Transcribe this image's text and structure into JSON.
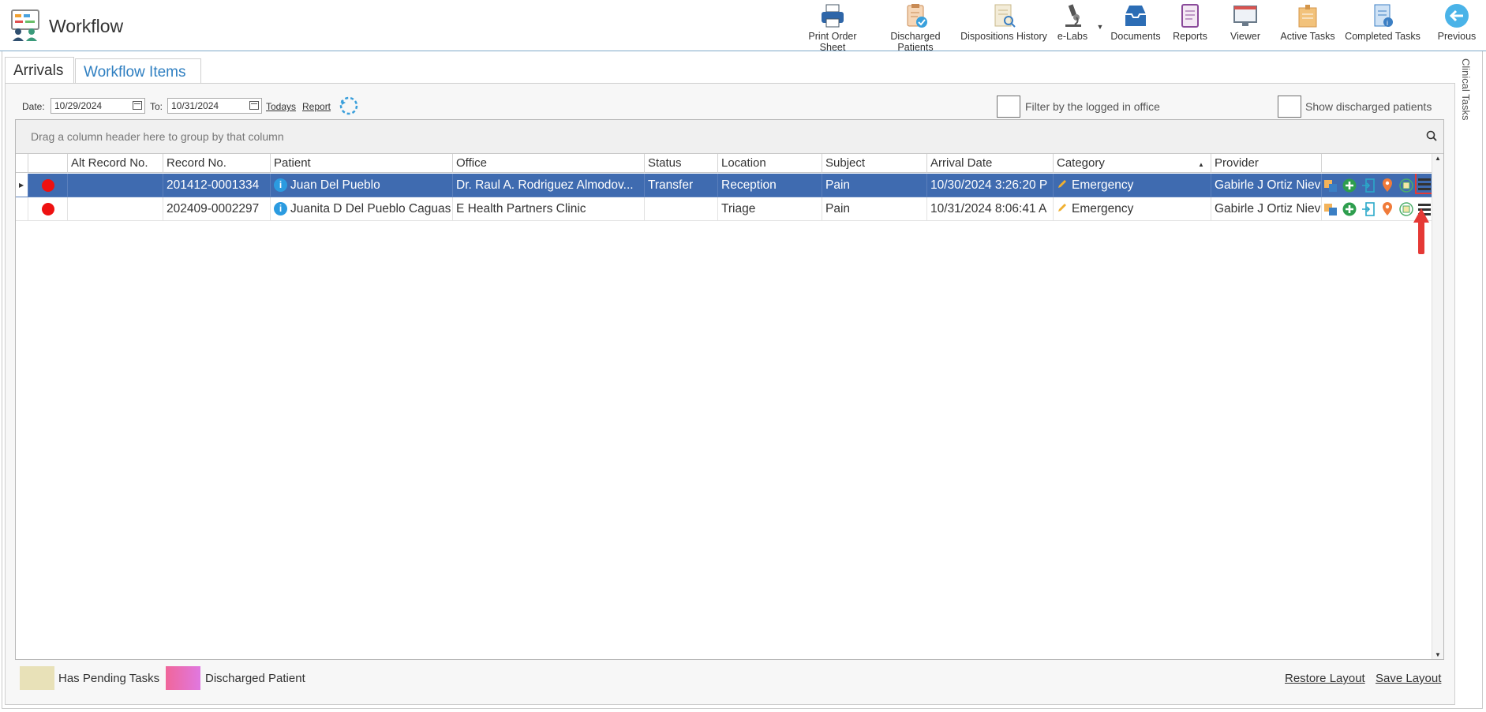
{
  "app": {
    "title": "Workflow"
  },
  "toolbar": {
    "print_order_sheet": "Print Order Sheet",
    "discharged_patients": "Discharged Patients",
    "dispositions_history": "Dispositions History",
    "e_labs": "e-Labs",
    "documents": "Documents",
    "reports": "Reports",
    "viewer": "Viewer",
    "active_tasks": "Active Tasks",
    "completed_tasks": "Completed Tasks",
    "previous": "Previous"
  },
  "tabs": {
    "arrivals": "Arrivals",
    "workflow_items": "Workflow Items"
  },
  "side_panel": {
    "label": "Clinical Tasks"
  },
  "filters": {
    "date_label": "Date:",
    "date_value": "10/29/2024",
    "to_label": "To:",
    "to_value": "10/31/2024",
    "todays": "Todays",
    "report": "Report",
    "filter_office": "Filter by the logged in office",
    "show_discharged": "Show discharged patients"
  },
  "grid": {
    "group_hint": "Drag a column header here to group by that column",
    "columns": {
      "alt_record": "Alt Record No.",
      "record": "Record No.",
      "patient": "Patient",
      "office": "Office",
      "status": "Status",
      "location": "Location",
      "subject": "Subject",
      "arrival": "Arrival Date",
      "category": "Category",
      "provider": "Provider"
    },
    "rows": [
      {
        "alt_record": "",
        "record": "201412-0001334",
        "patient": "Juan Del Pueblo",
        "office": "Dr. Raul A. Rodriguez Almodov...",
        "status": "Transfer",
        "location": "Reception",
        "subject": "Pain",
        "arrival": "10/30/2024 3:26:20 P",
        "category": "Emergency",
        "provider": "Gabirle J Ortiz Nieve"
      },
      {
        "alt_record": "",
        "record": "202409-0002297",
        "patient": "Juanita D Del Pueblo Caguas",
        "office": "E Health Partners Clinic",
        "status": "",
        "location": "Triage",
        "subject": "Pain",
        "arrival": "10/31/2024 8:06:41 A",
        "category": "Emergency",
        "provider": "Gabirle J Ortiz Nieve"
      }
    ]
  },
  "legend": {
    "pending": "Has Pending Tasks",
    "discharged": "Discharged Patient"
  },
  "layout": {
    "restore": "Restore Layout",
    "save": "Save Layout"
  },
  "colors": {
    "accent": "#2f7fc1",
    "selected_row": "#3f6bb0",
    "pending": "#e8e1b8",
    "status_dot": "#e11111",
    "highlight": "#e53935"
  }
}
